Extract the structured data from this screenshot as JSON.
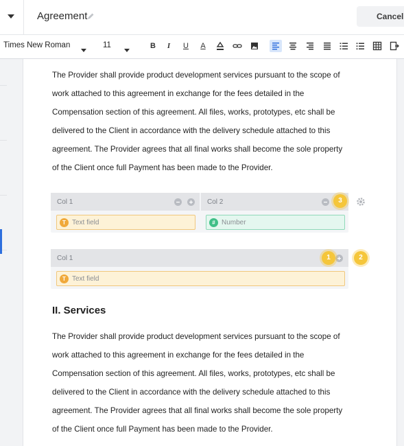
{
  "header": {
    "title": "Agreement",
    "cancel_label": "Cancel"
  },
  "toolbar": {
    "font_family": "Times New Roman",
    "font_size": "11",
    "bold_label": "B",
    "italic_label": "I",
    "underline_label": "U",
    "text_color_label": "A",
    "icons": [
      "highlight-icon",
      "link-icon",
      "image-icon",
      "align-left-icon",
      "align-center-icon",
      "align-right-icon",
      "justify-icon",
      "ordered-list-icon",
      "bullet-list-icon",
      "table-icon",
      "insert-field-icon"
    ]
  },
  "content": {
    "paragraph1": [
      "The Provider shall provide product development services pursuant to the scope of",
      "work attached to this agreement in exchange for the fees detailed in the",
      "Compensation section of this agreement. All files, works, prototypes, etc shall be",
      "delivered to the Client in accordance with the delivery schedule attached to this",
      "agreement. The Provider agrees that all final works shall become the sole property",
      "of the Client once full Payment has been made to the Provider."
    ],
    "heading": "II. Services",
    "paragraph2": [
      "The Provider shall provide product development services pursuant to the scope of",
      "work attached to this agreement in exchange for the fees detailed in the",
      "Compensation section of this agreement. All files, works, prototypes, etc shall be",
      "delivered to the Client in accordance with the delivery schedule attached to this",
      "agreement. The Provider agrees that all final works shall become the sole property",
      "of the Client once full Payment has been made to the Provider."
    ]
  },
  "table1": {
    "col1_label": "Col 1",
    "col2_label": "Col 2",
    "field1_placeholder": "Text field",
    "field2_placeholder": "Number"
  },
  "table2": {
    "col1_label": "Col 1",
    "field1_placeholder": "Text field"
  },
  "badges": {
    "one": "1",
    "two": "2",
    "three": "3"
  },
  "colors": {
    "accent": "#2f6fde",
    "text_field": "#f0a93b",
    "number_field": "#3fbf87",
    "badge": "#f5c63b"
  }
}
